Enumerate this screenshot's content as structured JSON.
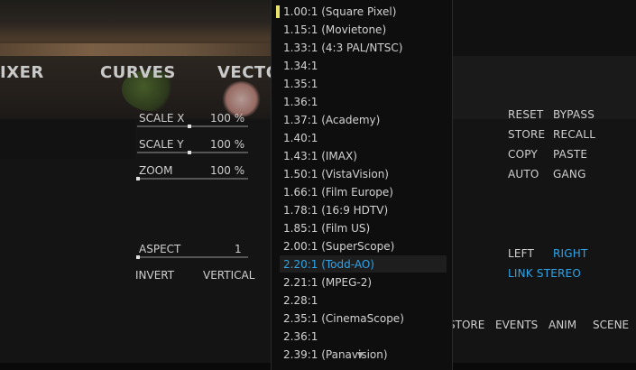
{
  "tabs": [
    "IXER",
    "CURVES",
    "VECTO"
  ],
  "params": {
    "scale_x": {
      "label": "SCALE X",
      "value": "100 %"
    },
    "scale_y": {
      "label": "SCALE Y",
      "value": "100 %"
    },
    "zoom": {
      "label": "ZOOM",
      "value": "100 %"
    },
    "aspect": {
      "label": "ASPECT",
      "value": "1"
    }
  },
  "toggles": {
    "invert": "INVERT",
    "vertical": "VERTICAL"
  },
  "right_buttons": {
    "reset": "RESET",
    "bypass": "BYPASS",
    "store": "STORE",
    "recall": "RECALL",
    "copy": "COPY",
    "paste": "PASTE",
    "auto": "AUTO",
    "gang": "GANG",
    "left": "LEFT",
    "right": "RIGHT",
    "link_stereo": "LINK STEREO"
  },
  "bottom_bar": {
    "store": "STORE",
    "events": "EVENTS",
    "anim": "ANIM",
    "scene": "SCENE"
  },
  "aspect_menu": {
    "selected": "2.20:1 (Todd-AO)",
    "items": [
      "1.00:1 (Square Pixel)",
      "1.15:1 (Movietone)",
      "1.33:1 (4:3 PAL/NTSC)",
      "1.34:1",
      "1.35:1",
      "1.36:1",
      "1.37:1 (Academy)",
      "1.40:1",
      "1.43:1 (IMAX)",
      "1.50:1 (VistaVision)",
      "1.66:1 (Film Europe)",
      "1.78:1 (16:9 HDTV)",
      "1.85:1 (Film US)",
      "2.00:1 (SuperScope)",
      "2.20:1 (Todd-AO)",
      "2.21:1 (MPEG-2)",
      "2.28:1",
      "2.35:1 (CinemaScope)",
      "2.36:1",
      "2.39:1 (Panavision)"
    ]
  },
  "colors": {
    "accent_blue": "#2fa4e7",
    "marker_yellow": "#e8e36a"
  }
}
